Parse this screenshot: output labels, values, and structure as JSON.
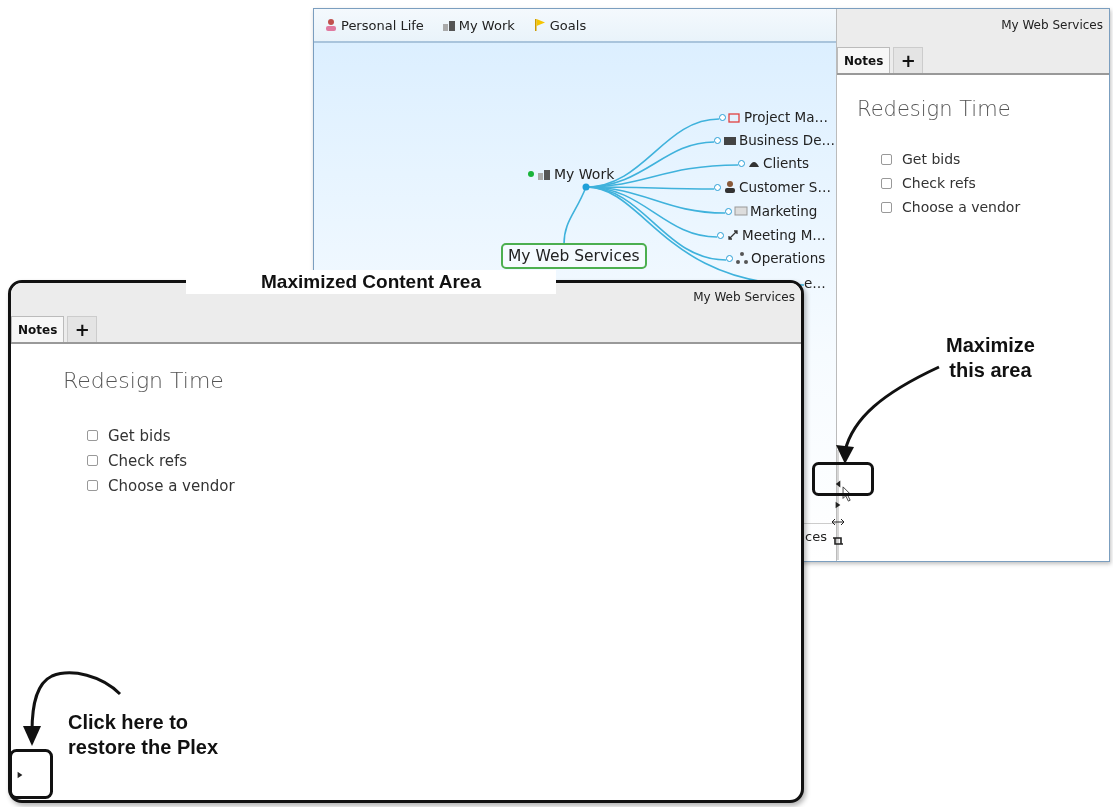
{
  "back_window": {
    "plex": {
      "tabs": [
        {
          "label": "Personal Life",
          "selected": false
        },
        {
          "label": "My Work",
          "selected": false
        },
        {
          "label": "Goals",
          "selected": false
        }
      ],
      "map": {
        "central_node": "My Work",
        "selected_node": "My Web Services",
        "child_nodes": [
          "Project Ma…",
          "Business De…",
          "Clients",
          "Customer S…",
          "Marketing",
          "Meeting M…",
          "Operations",
          "e…"
        ]
      },
      "footer_text": "ces"
    },
    "panel": {
      "title": "My Web Services",
      "tabs": [
        {
          "label": "Notes",
          "selected": true
        },
        {
          "label": "+",
          "selected": false
        }
      ],
      "note_title": "Redesign Time",
      "checklist": [
        {
          "text": "Get bids",
          "checked": false
        },
        {
          "text": "Check refs",
          "checked": false
        },
        {
          "text": "Choose a vendor",
          "checked": false
        }
      ]
    }
  },
  "front_window": {
    "title": "My Web Services",
    "tabs": [
      {
        "label": "Notes",
        "selected": true
      },
      {
        "label": "+",
        "selected": false
      }
    ],
    "note_title": "Redesign Time",
    "checklist": [
      {
        "text": "Get bids",
        "checked": false
      },
      {
        "text": "Check refs",
        "checked": false
      },
      {
        "text": "Choose a vendor",
        "checked": false
      }
    ]
  },
  "annotations": [
    {
      "lines": [
        "Maximized Content Area"
      ]
    },
    {
      "lines": [
        "Maximize",
        "this area"
      ]
    },
    {
      "lines": [
        "Click here to",
        "restore the Plex"
      ]
    }
  ]
}
